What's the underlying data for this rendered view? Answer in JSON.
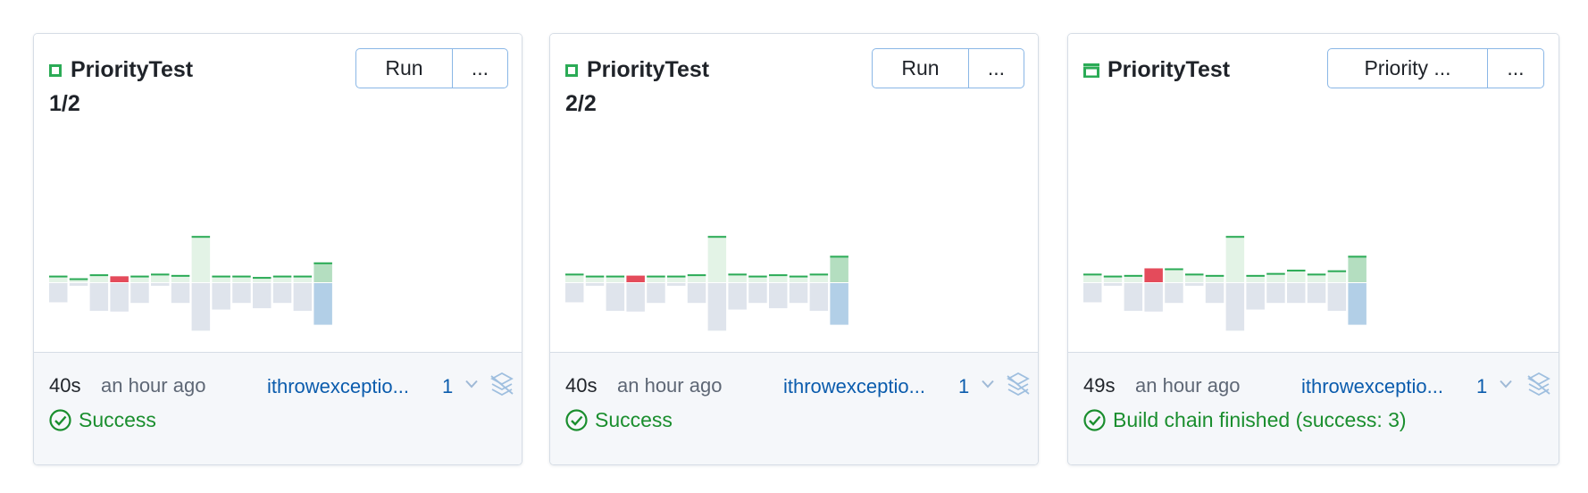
{
  "cards": [
    {
      "title": "PriorityTest",
      "subtitle": "1/2",
      "icon": "build-configuration-icon",
      "buttons": [
        "Run",
        "..."
      ],
      "duration": "40s",
      "when": "an hour ago",
      "user": "ithrowexceptio...",
      "changes_count": "1",
      "status": "Success",
      "chart_data": {
        "type": "bar",
        "success": [
          true,
          true,
          true,
          false,
          true,
          true,
          true,
          true,
          true,
          true,
          true,
          true,
          true,
          true
        ],
        "duration": [
          1.0,
          0.6,
          1.2,
          0.9,
          1.0,
          1.3,
          1.1,
          7.0,
          1.0,
          1.0,
          0.8,
          1.0,
          1.0,
          3.0
        ],
        "wait": [
          2.9,
          0.4,
          4.2,
          4.3,
          3.0,
          0.4,
          3.0,
          7.2,
          4.0,
          3.0,
          3.8,
          3.0,
          4.2,
          6.3
        ]
      }
    },
    {
      "title": "PriorityTest",
      "subtitle": "2/2",
      "icon": "build-configuration-icon",
      "buttons": [
        "Run",
        "..."
      ],
      "duration": "40s",
      "when": "an hour ago",
      "user": "ithrowexceptio...",
      "changes_count": "1",
      "status": "Success",
      "chart_data": {
        "type": "bar",
        "success": [
          true,
          true,
          true,
          false,
          true,
          true,
          true,
          true,
          true,
          true,
          true,
          true,
          true,
          true
        ],
        "duration": [
          1.3,
          1.0,
          1.0,
          1.0,
          1.0,
          1.0,
          1.2,
          7.0,
          1.3,
          1.0,
          1.2,
          1.0,
          1.3,
          4.0
        ],
        "wait": [
          2.9,
          0.4,
          4.2,
          4.3,
          3.0,
          0.4,
          3.0,
          7.2,
          4.0,
          3.0,
          3.8,
          3.0,
          4.2,
          6.3
        ]
      }
    },
    {
      "title": "PriorityTest",
      "subtitle": "",
      "icon": "build-chain-icon",
      "buttons": [
        "Priority ...",
        "..."
      ],
      "duration": "49s",
      "when": "an hour ago",
      "user": "ithrowexceptio...",
      "changes_count": "1",
      "status": "Build chain finished (success: 3)",
      "chart_data": {
        "type": "bar",
        "success": [
          true,
          true,
          true,
          false,
          true,
          true,
          true,
          true,
          true,
          true,
          true,
          true,
          true,
          true
        ],
        "duration": [
          1.3,
          1.0,
          1.1,
          2.1,
          2.1,
          1.3,
          1.1,
          7.0,
          1.1,
          1.4,
          1.9,
          1.3,
          1.8,
          4.0
        ],
        "wait": [
          2.9,
          0.4,
          4.2,
          4.3,
          3.0,
          0.4,
          3.0,
          7.2,
          4.0,
          3.0,
          3.0,
          3.0,
          4.2,
          6.3
        ]
      }
    }
  ],
  "colors": {
    "success_fill": "#e3f3e6",
    "success_line": "#2bab56",
    "failed_fill": "#e44b5b",
    "wait_fill": "#dfe4ec",
    "last_success_fill": "#b4dec0",
    "last_wait_fill": "#b2cfe7",
    "link": "#0b5cad",
    "status_green": "#1a8e2e"
  }
}
